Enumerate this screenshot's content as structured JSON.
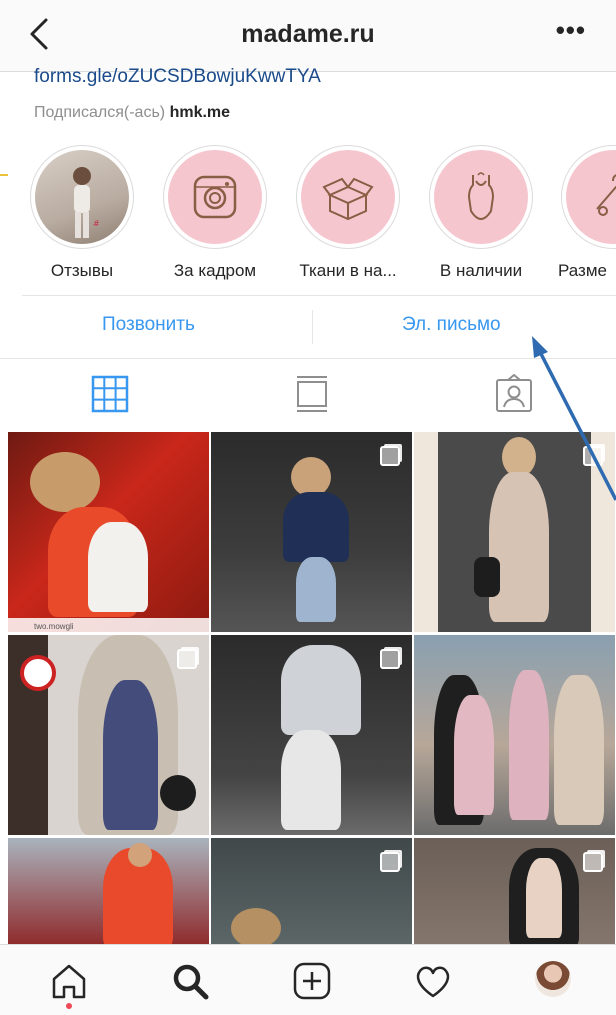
{
  "header": {
    "title": "madame.ru",
    "more_label": "•••",
    "back_icon": "chevron-left-icon"
  },
  "profile": {
    "link": "forms.gle/oZUCSDBowjuKwwTYA",
    "followed_prefix": "Подписался(-ась)",
    "followed_by": "hmk.me"
  },
  "highlights": [
    {
      "label": "Отзывы",
      "icon": "photo"
    },
    {
      "label": "За кадром",
      "icon": "camera-icon"
    },
    {
      "label": "Ткани в на...",
      "icon": "box-icon"
    },
    {
      "label": "В наличии",
      "icon": "bodysuit-icon"
    },
    {
      "label": "Разме",
      "icon": "hanger-icon"
    }
  ],
  "actions": {
    "call": "Позвонить",
    "email": "Эл. письмо"
  },
  "tabs": [
    "grid-icon",
    "feed-icon",
    "tagged-icon"
  ],
  "grid": {
    "watermark": "two.mowgli"
  },
  "bottom_nav": [
    "home-icon",
    "search-icon",
    "new-post-icon",
    "heart-icon",
    "profile-avatar"
  ],
  "colors": {
    "accent": "#3897f0",
    "highlight_bg": "#f6c6cf",
    "annotation_arrow": "#2f6bb0",
    "link": "#1a4a8a"
  }
}
